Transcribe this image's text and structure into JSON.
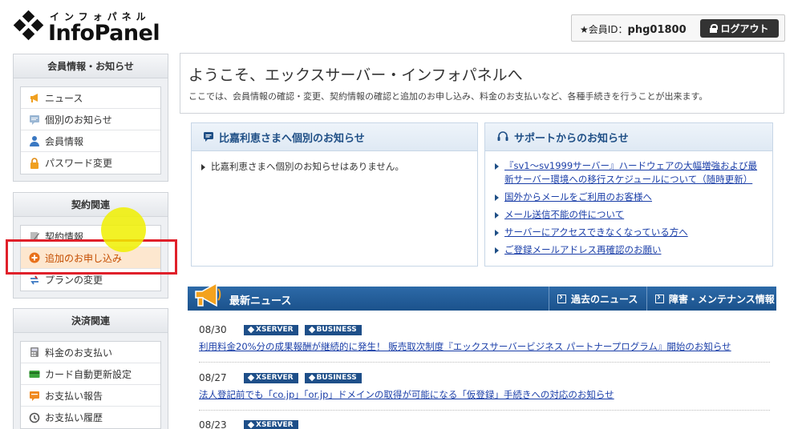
{
  "header": {
    "logo_kana": "インフォパネル",
    "logo_name": "InfoPanel",
    "member_label": "★会員ID：",
    "member_id": "phg01800",
    "logout_label": "ログアウト"
  },
  "sidebar": {
    "groups": [
      {
        "title": "会員情報・お知らせ",
        "items": [
          {
            "label": "ニュース",
            "icon": "megaphone-icon"
          },
          {
            "label": "個別のお知らせ",
            "icon": "message-icon"
          },
          {
            "label": "会員情報",
            "icon": "user-icon"
          },
          {
            "label": "パスワード変更",
            "icon": "lock-icon"
          }
        ]
      },
      {
        "title": "契約関連",
        "items": [
          {
            "label": "契約情報",
            "icon": "contract-icon"
          },
          {
            "label": "追加のお申し込み",
            "icon": "plus-circle-icon",
            "active": true
          },
          {
            "label": "プランの変更",
            "icon": "swap-icon"
          }
        ]
      },
      {
        "title": "決済関連",
        "items": [
          {
            "label": "料金のお支払い",
            "icon": "calculator-icon"
          },
          {
            "label": "カード自動更新設定",
            "icon": "card-icon"
          },
          {
            "label": "お支払い報告",
            "icon": "report-icon"
          },
          {
            "label": "お支払い履歴",
            "icon": "history-icon"
          }
        ]
      }
    ]
  },
  "welcome": {
    "title": "ようこそ、エックスサーバー・インフォパネルへ",
    "description": "ここでは、会員情報の確認・変更、契約情報の確認と追加のお申し込み、料金のお支払いなど、各種手続きを行うことが出来ます。"
  },
  "personal_notice": {
    "title": "比嘉利恵さまへ個別のお知らせ",
    "items": [
      "比嘉利恵さまへ個別のお知らせはありません。"
    ]
  },
  "support_notice": {
    "title": "サポートからのお知らせ",
    "items": [
      "『sv1～sv1999サーバー』ハードウェアの大幅増強および最新サーバー環境への移行スケジュールについて（随時更新）",
      "国外からメールをご利用のお客様へ",
      "メール送信不能の件について",
      "サーバーにアクセスできなくなっている方へ",
      "ご登録メールアドレス再確認のお願い"
    ]
  },
  "news": {
    "title": "最新ニュース",
    "past_link": "過去のニュース",
    "maintenance_link": "障害・メンテナンス情報",
    "items": [
      {
        "date": "08/30",
        "tags": [
          "XSERVER",
          "BUSINESS"
        ],
        "headline": "利用料金20%分の成果報酬が継続的に発生！ 販売取次制度『エックスサーバービジネス パートナープログラム』開始のお知らせ"
      },
      {
        "date": "08/27",
        "tags": [
          "XSERVER",
          "BUSINESS"
        ],
        "headline": "法人登記前でも「co.jp」「or.jp」ドメインの取得が可能になる「仮登録」手続きへの対応のお知らせ"
      },
      {
        "date": "08/23",
        "tags": [
          "XSERVER"
        ],
        "headline": ""
      }
    ]
  },
  "colors": {
    "accent_blue": "#1f4f86",
    "active_orange": "#c44d00",
    "highlight_red": "#e0202a"
  }
}
